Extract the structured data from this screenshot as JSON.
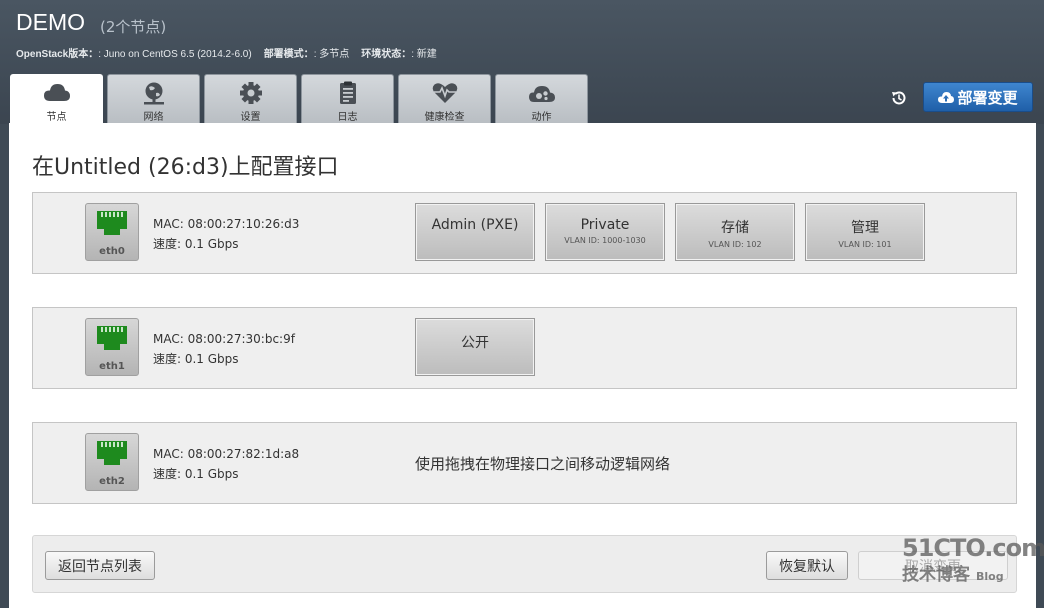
{
  "header": {
    "title": "DEMO",
    "subtitle": "(2个节点)",
    "openstack_label": "OpenStack版本：",
    "openstack_value": ": Juno on CentOS 6.5 (2014.2-6.0)",
    "deploy_mode_label": "部署模式：",
    "deploy_mode_value": ": 多节点",
    "env_status_label": "环境状态：",
    "env_status_value": ": 新建"
  },
  "tabs": [
    {
      "label": "节点",
      "icon": "cloud-icon",
      "active": true
    },
    {
      "label": "网络",
      "icon": "network-icon",
      "active": false
    },
    {
      "label": "设置",
      "icon": "gear-icon",
      "active": false
    },
    {
      "label": "日志",
      "icon": "clipboard-icon",
      "active": false
    },
    {
      "label": "健康检查",
      "icon": "heart-pulse-icon",
      "active": false
    },
    {
      "label": "动作",
      "icon": "cloud-gears-icon",
      "active": false
    }
  ],
  "deploy_button": {
    "label": "部署变更",
    "icon": "cloud-upload-icon"
  },
  "page_title": "在Untitled (26:d3)上配置接口",
  "interfaces": [
    {
      "name": "eth0",
      "mac": "MAC: 08:00:27:10:26:d3",
      "speed": "速度: 0.1 Gbps",
      "networks": [
        {
          "name": "Admin (PXE)",
          "vlan": ""
        },
        {
          "name": "Private",
          "vlan": "VLAN ID: 1000-1030"
        },
        {
          "name": "存储",
          "vlan": "VLAN ID: 102"
        },
        {
          "name": "管理",
          "vlan": "VLAN ID: 101"
        }
      ]
    },
    {
      "name": "eth1",
      "mac": "MAC: 08:00:27:30:bc:9f",
      "speed": "速度: 0.1 Gbps",
      "networks": [
        {
          "name": "公开",
          "vlan": ""
        }
      ]
    },
    {
      "name": "eth2",
      "mac": "MAC: 08:00:27:82:1d:a8",
      "speed": "速度: 0.1 Gbps",
      "hint": "使用拖拽在物理接口之间移动逻辑网络"
    }
  ],
  "footer": {
    "back_label": "返回节点列表",
    "restore_label": "恢复默认",
    "cancel_label": "取消变更"
  },
  "watermark": {
    "line1": "51CTO.com",
    "line2": "技术博客",
    "line2_small": "Blog"
  },
  "colors": {
    "accent": "#2f74bf",
    "port_green": "#1e8a1e"
  }
}
